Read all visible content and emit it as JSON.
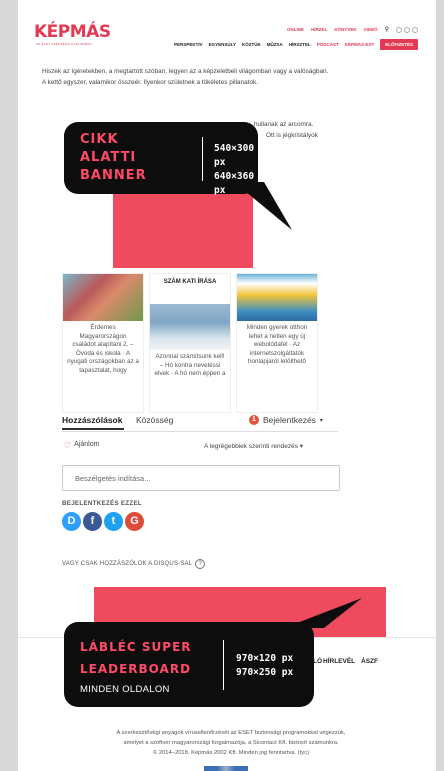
{
  "header": {
    "logo": "KÉPMÁS",
    "logo_tagline": "AZ ÉLET SZÉPSÉGE CSALÁDBAN",
    "topnav": [
      "ONLINE",
      "HÍRZEL",
      "KÖNYVEK",
      "VIDEÓ"
    ],
    "mainnav": [
      "PERSPEKTÍV",
      "EGYENSÚLY",
      "KÖZTÜK",
      "MŰZSA",
      "HÍRSZTEL",
      "PODCAST",
      "KÉPMÁS-EST"
    ],
    "subscribe": "ELŐFIZETÉS"
  },
  "article": {
    "paragraph1": "Hiszek az ígéretekben, a megtartott szóban, legyen az a képzeletbeli világomban vagy a valóságban. A kettő egyszer, valamikor összeér. Ilyenkor születnek a tökéletes pillanatok.",
    "paragraph2_end": "hullanak az arcomra.",
    "paragraph2_end2": "Ott is jégkristályok"
  },
  "callouts": {
    "banner_under_article": {
      "title_lines": [
        "CIKK",
        "ALATTI",
        "BANNER"
      ],
      "sizes": [
        "540×300 px",
        "640×360 px"
      ]
    },
    "footer_leaderboard": {
      "title_lines": [
        "LÁBLÉC SUPER",
        "LEADERBOARD"
      ],
      "sizes": [
        "970×120 px",
        "970×250 px"
      ],
      "note": "MINDEN OLDALON"
    }
  },
  "related": [
    {
      "tag": "",
      "text": "Érdemes Magyarországon családot alapítani 2. – Óvoda és iskola · A nyugati országokban az a tapasztalat, hogy"
    },
    {
      "tag": "SZÁM KATI ÍRÁSA",
      "text": "Azonnal számítsunk kell! – Hó kontra neveléssi elvek · A hó nem éppen a"
    },
    {
      "tag": "",
      "text": "Minden gyerek otthon lehet a netlen egy új webolódafel · Az internetszolgáltatók honlapjaról letölthető"
    }
  ],
  "comments": {
    "tab_comments": "Hozzászólások",
    "tab_community": "Közösség",
    "login": "Bejelentkezés",
    "login_badge": "1",
    "recommend": "Ajánlom",
    "sort": "A legrégebbiek szerinti rendezés",
    "input_placeholder": "Beszélgetés indítása...",
    "login_with": "BEJELENTKEZÉS EZZEL",
    "services": [
      "D",
      "f",
      "t",
      "G"
    ],
    "guest": "VAGY CSAK HOZZÁSZÓLOK A DISQUS-SAL",
    "guest_icon": "?"
  },
  "footer": {
    "links": [
      "LÓ",
      "HÍRLEVÉL",
      "ÁSZF"
    ],
    "legal_1": "A szerkesztőségi anyagok vírusellenőrzését az ESET biztonsági programokkal végezzük,",
    "legal_2": "amelyet a szoftver magyarországi forgalmazója, a Sicontact Kft. biztosít számunkra.",
    "copyright": "© 2014–2018. Képmás 2002 Kft. Minden jog fenntartva. (tyc)"
  },
  "colors": {
    "brand": "#e23a53",
    "banner": "#ee4b5e",
    "callout_bg": "#0d0d0d"
  }
}
